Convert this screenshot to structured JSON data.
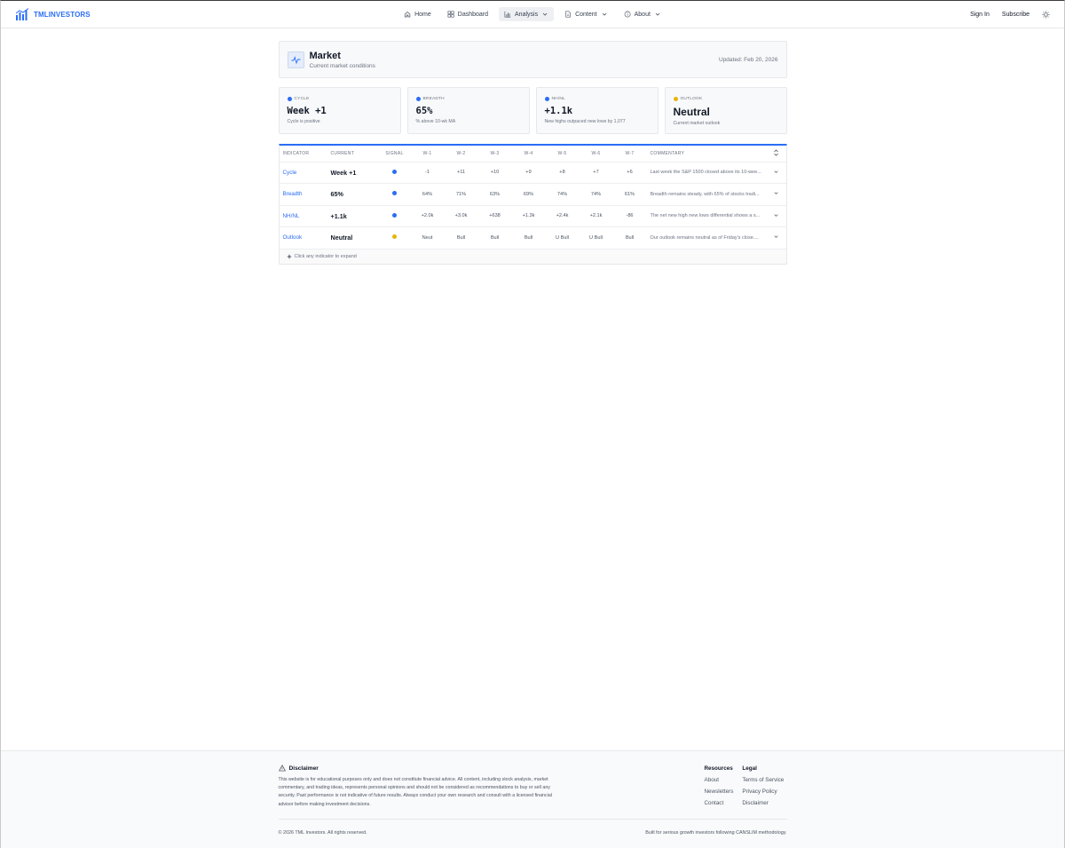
{
  "brand": {
    "name": "TMLINVESTORS"
  },
  "nav": {
    "items": [
      {
        "label": "Home",
        "icon": "home-icon"
      },
      {
        "label": "Dashboard",
        "icon": "dashboard-icon"
      },
      {
        "label": "Analysis",
        "icon": "bar-chart-icon",
        "active": true
      },
      {
        "label": "Content",
        "icon": "document-icon"
      },
      {
        "label": "About",
        "icon": "info-icon"
      }
    ],
    "sign_in": "Sign In",
    "subscribe": "Subscribe"
  },
  "header": {
    "title": "Market",
    "subtitle": "Current market conditions",
    "updated": "Updated: Feb 20, 2026"
  },
  "cards": [
    {
      "label": "CYCLE",
      "value": "Week +1",
      "desc": "Cycle is positive",
      "dot_color": "#2a6df5"
    },
    {
      "label": "BREADTH",
      "value": "65%",
      "desc": "% above 10-wk MA",
      "dot_color": "#2a6df5"
    },
    {
      "label": "NH/NL",
      "value": "+1.1k",
      "desc": "New highs outpaced new lows by 1,077",
      "dot_color": "#2a6df5"
    },
    {
      "label": "OUTLOOK",
      "value": "Neutral",
      "desc": "Current market outlook",
      "dot_color": "#eab308"
    }
  ],
  "table": {
    "headers": [
      "INDICATOR",
      "CURRENT",
      "SIGNAL",
      "W-1",
      "W-2",
      "W-3",
      "W-4",
      "W-5",
      "W-6",
      "W-7",
      "COMMENTARY"
    ],
    "rows": [
      {
        "indicator": "Cycle",
        "current": "Week +1",
        "signal_color": "#2a6df5",
        "weeks": [
          "-1",
          "+11",
          "+10",
          "+9",
          "+8",
          "+7",
          "+6"
        ],
        "commentary": "Last week the S&P 1500 closed above its 10-wee..."
      },
      {
        "indicator": "Breadth",
        "current": "65%",
        "signal_color": "#2a6df5",
        "weeks": [
          "64%",
          "71%",
          "63%",
          "69%",
          "74%",
          "74%",
          "61%"
        ],
        "commentary": "Breadth remains steady, with 65% of stocks tradi..."
      },
      {
        "indicator": "NH/NL",
        "current": "+1.1k",
        "signal_color": "#2a6df5",
        "weeks": [
          "+2.0k",
          "+3.0k",
          "+638",
          "+1.3k",
          "+2.4k",
          "+2.1k",
          "-86"
        ],
        "commentary": "The net new high new lows differential shows a s..."
      },
      {
        "indicator": "Outlook",
        "current": "Neutral",
        "signal_color": "#eab308",
        "weeks": [
          "Neut",
          "Bull",
          "Bull",
          "Bull",
          "U Bull",
          "U Bull",
          "Bull"
        ],
        "commentary": "Our outlook remains neutral as of Friday's close...."
      }
    ],
    "footer_hint": "Click any indicator to expand"
  },
  "footer": {
    "disclaimer_title": "Disclaimer",
    "disclaimer_text": "This website is for educational purposes only and does not constitute financial advice. All content, including stock analysis, market commentary, and trading ideas, represents personal opinions and should not be considered as recommendations to buy or sell any security. Past performance is not indicative of future results. Always conduct your own research and consult with a licensed financial advisor before making investment decisions.",
    "resources": {
      "title": "Resources",
      "links": [
        "About",
        "Newsletters",
        "Contact"
      ]
    },
    "legal": {
      "title": "Legal",
      "links": [
        "Terms of Service",
        "Privacy Policy",
        "Disclaimer"
      ]
    },
    "copyright": "© 2026 TML Investors. All rights reserved.",
    "built": "Built for serious growth investors following CANSLIM methodology."
  }
}
